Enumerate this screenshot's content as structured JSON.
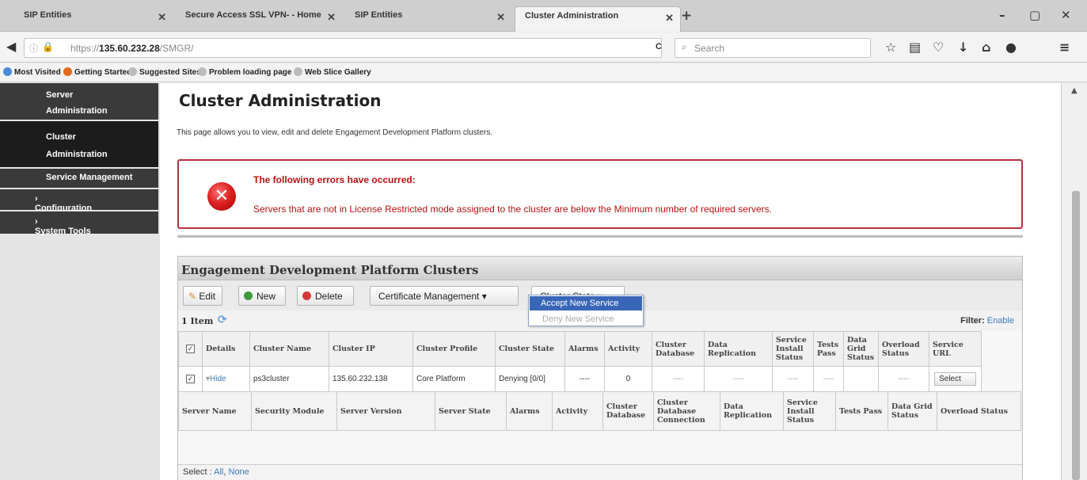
{
  "browser": {
    "tabs": [
      {
        "title": "SIP Entities"
      },
      {
        "title": "Secure Access SSL VPN- - Home"
      },
      {
        "title": "SIP Entities"
      },
      {
        "title": "Cluster Administration"
      }
    ],
    "new_tab": "+",
    "window_controls": {
      "minimize": "–",
      "restore": "▢",
      "close": "✕"
    },
    "url_prefix": "https://",
    "url_host": "135.60.232.28",
    "url_path": "/SMGR/",
    "search_placeholder": "Search",
    "reload": "C",
    "bookmarks": [
      "Most Visited",
      "Getting Started",
      "Suggested Sites",
      "Problem loading page",
      "Web Slice Gallery"
    ]
  },
  "sidebar": {
    "items": [
      {
        "label": "Server Administration"
      },
      {
        "label": "Cluster Administration"
      },
      {
        "label": "Service Management"
      },
      {
        "label": "Configuration"
      },
      {
        "label": "System Tools"
      }
    ]
  },
  "main": {
    "title": "Cluster Administration",
    "description": "This page allows you to view, edit and delete Engagement Development Platform clusters.",
    "error": {
      "heading": "The following errors have occurred:",
      "message": "Servers that are not in License Restricted mode assigned to the cluster are below the Minimum number of required servers."
    }
  },
  "panel": {
    "title": "Engagement Development Platform Clusters",
    "buttons": {
      "edit": "Edit",
      "new": "New",
      "delete": "Delete",
      "cert": "Certificate Management",
      "cluster_state": "Cluster State"
    },
    "dropdown": [
      "Accept New Service",
      "Deny New Service"
    ],
    "item_count": "1 Item",
    "filter_label": "Filter:",
    "filter_link": "Enable",
    "cluster_columns": [
      "Details",
      "Cluster Name",
      "Cluster IP",
      "Cluster Profile",
      "Cluster State",
      "Alarms",
      "Activity",
      "Cluster Database",
      "Data Replication",
      "Service Install Status",
      "Tests Pass",
      "Data Grid Status",
      "Overload Status",
      "Service URL"
    ],
    "cluster_row": {
      "details": "Hide",
      "name": "ps3cluster",
      "ip": "135.60.232.138",
      "profile": "Core Platform",
      "state": "Denying [0/0]",
      "alarms": "----",
      "activity": "0",
      "database": "----",
      "replication": "----",
      "install": "----",
      "tests": "----",
      "grid": "",
      "overload": "----",
      "url": "Select"
    },
    "server_columns": [
      "Server Name",
      "Security Module",
      "Server Version",
      "Server State",
      "Alarms",
      "Activity",
      "Cluster Database",
      "Cluster Database Connection",
      "Data Replication",
      "Service Install Status",
      "Tests Pass",
      "Data Grid Status",
      "Overload Status"
    ],
    "select_label": "Select :",
    "select_all": "All",
    "select_none": "None"
  },
  "colors": {
    "sidebar_dark": "#3a3a3a",
    "sidebar_active": "#1c1c1c",
    "error_border": "#b8303f",
    "error_text": "#b11111",
    "accent_blue": "#3a66b8"
  }
}
